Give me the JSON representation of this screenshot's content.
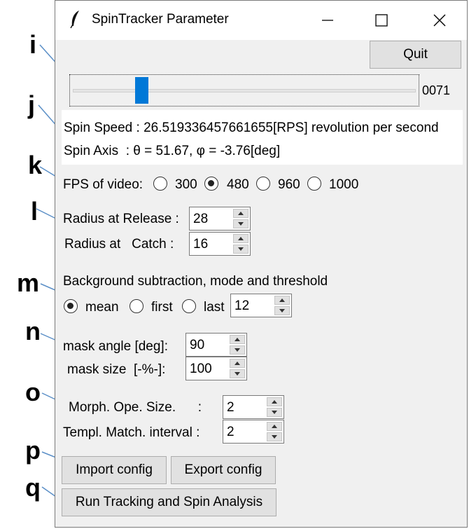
{
  "window": {
    "title": "SpinTracker Parameter"
  },
  "callouts": [
    "i",
    "j",
    "k",
    "l",
    "m",
    "n",
    "o",
    "p",
    "q"
  ],
  "quit_label": "Quit",
  "slider": {
    "value_label": "0071",
    "position_fraction": 0.19
  },
  "spin_speed_text": "Spin Speed : 26.519336457661655[RPS] revolution per second",
  "spin_axis_text": "Spin Axis  : θ = 51.67, φ = -3.76[deg]",
  "fps": {
    "label": "FPS of video:",
    "options": [
      "300",
      "480",
      "960",
      "1000"
    ],
    "selected": "480"
  },
  "radius": {
    "release_label": "Radius at Release :",
    "release_value": "28",
    "catch_label": "Radius at   Catch :",
    "catch_value": "16"
  },
  "background": {
    "label": "Background subtraction, mode and threshold",
    "options": [
      "mean",
      "first",
      "last"
    ],
    "selected": "mean",
    "threshold": "12"
  },
  "mask": {
    "angle_label": "mask angle [deg]:",
    "angle_value": "90",
    "size_label": "mask size  [-%-]:",
    "size_value": "100"
  },
  "morph": {
    "label": "Morph. Ope. Size.      :",
    "value": "2"
  },
  "templ": {
    "label": "Templ. Match. interval :",
    "value": "2"
  },
  "buttons": {
    "import": "Import config",
    "export": "Export config",
    "run": "Run Tracking and Spin Analysis"
  },
  "colors": {
    "slider_handle": "#0078d7"
  }
}
